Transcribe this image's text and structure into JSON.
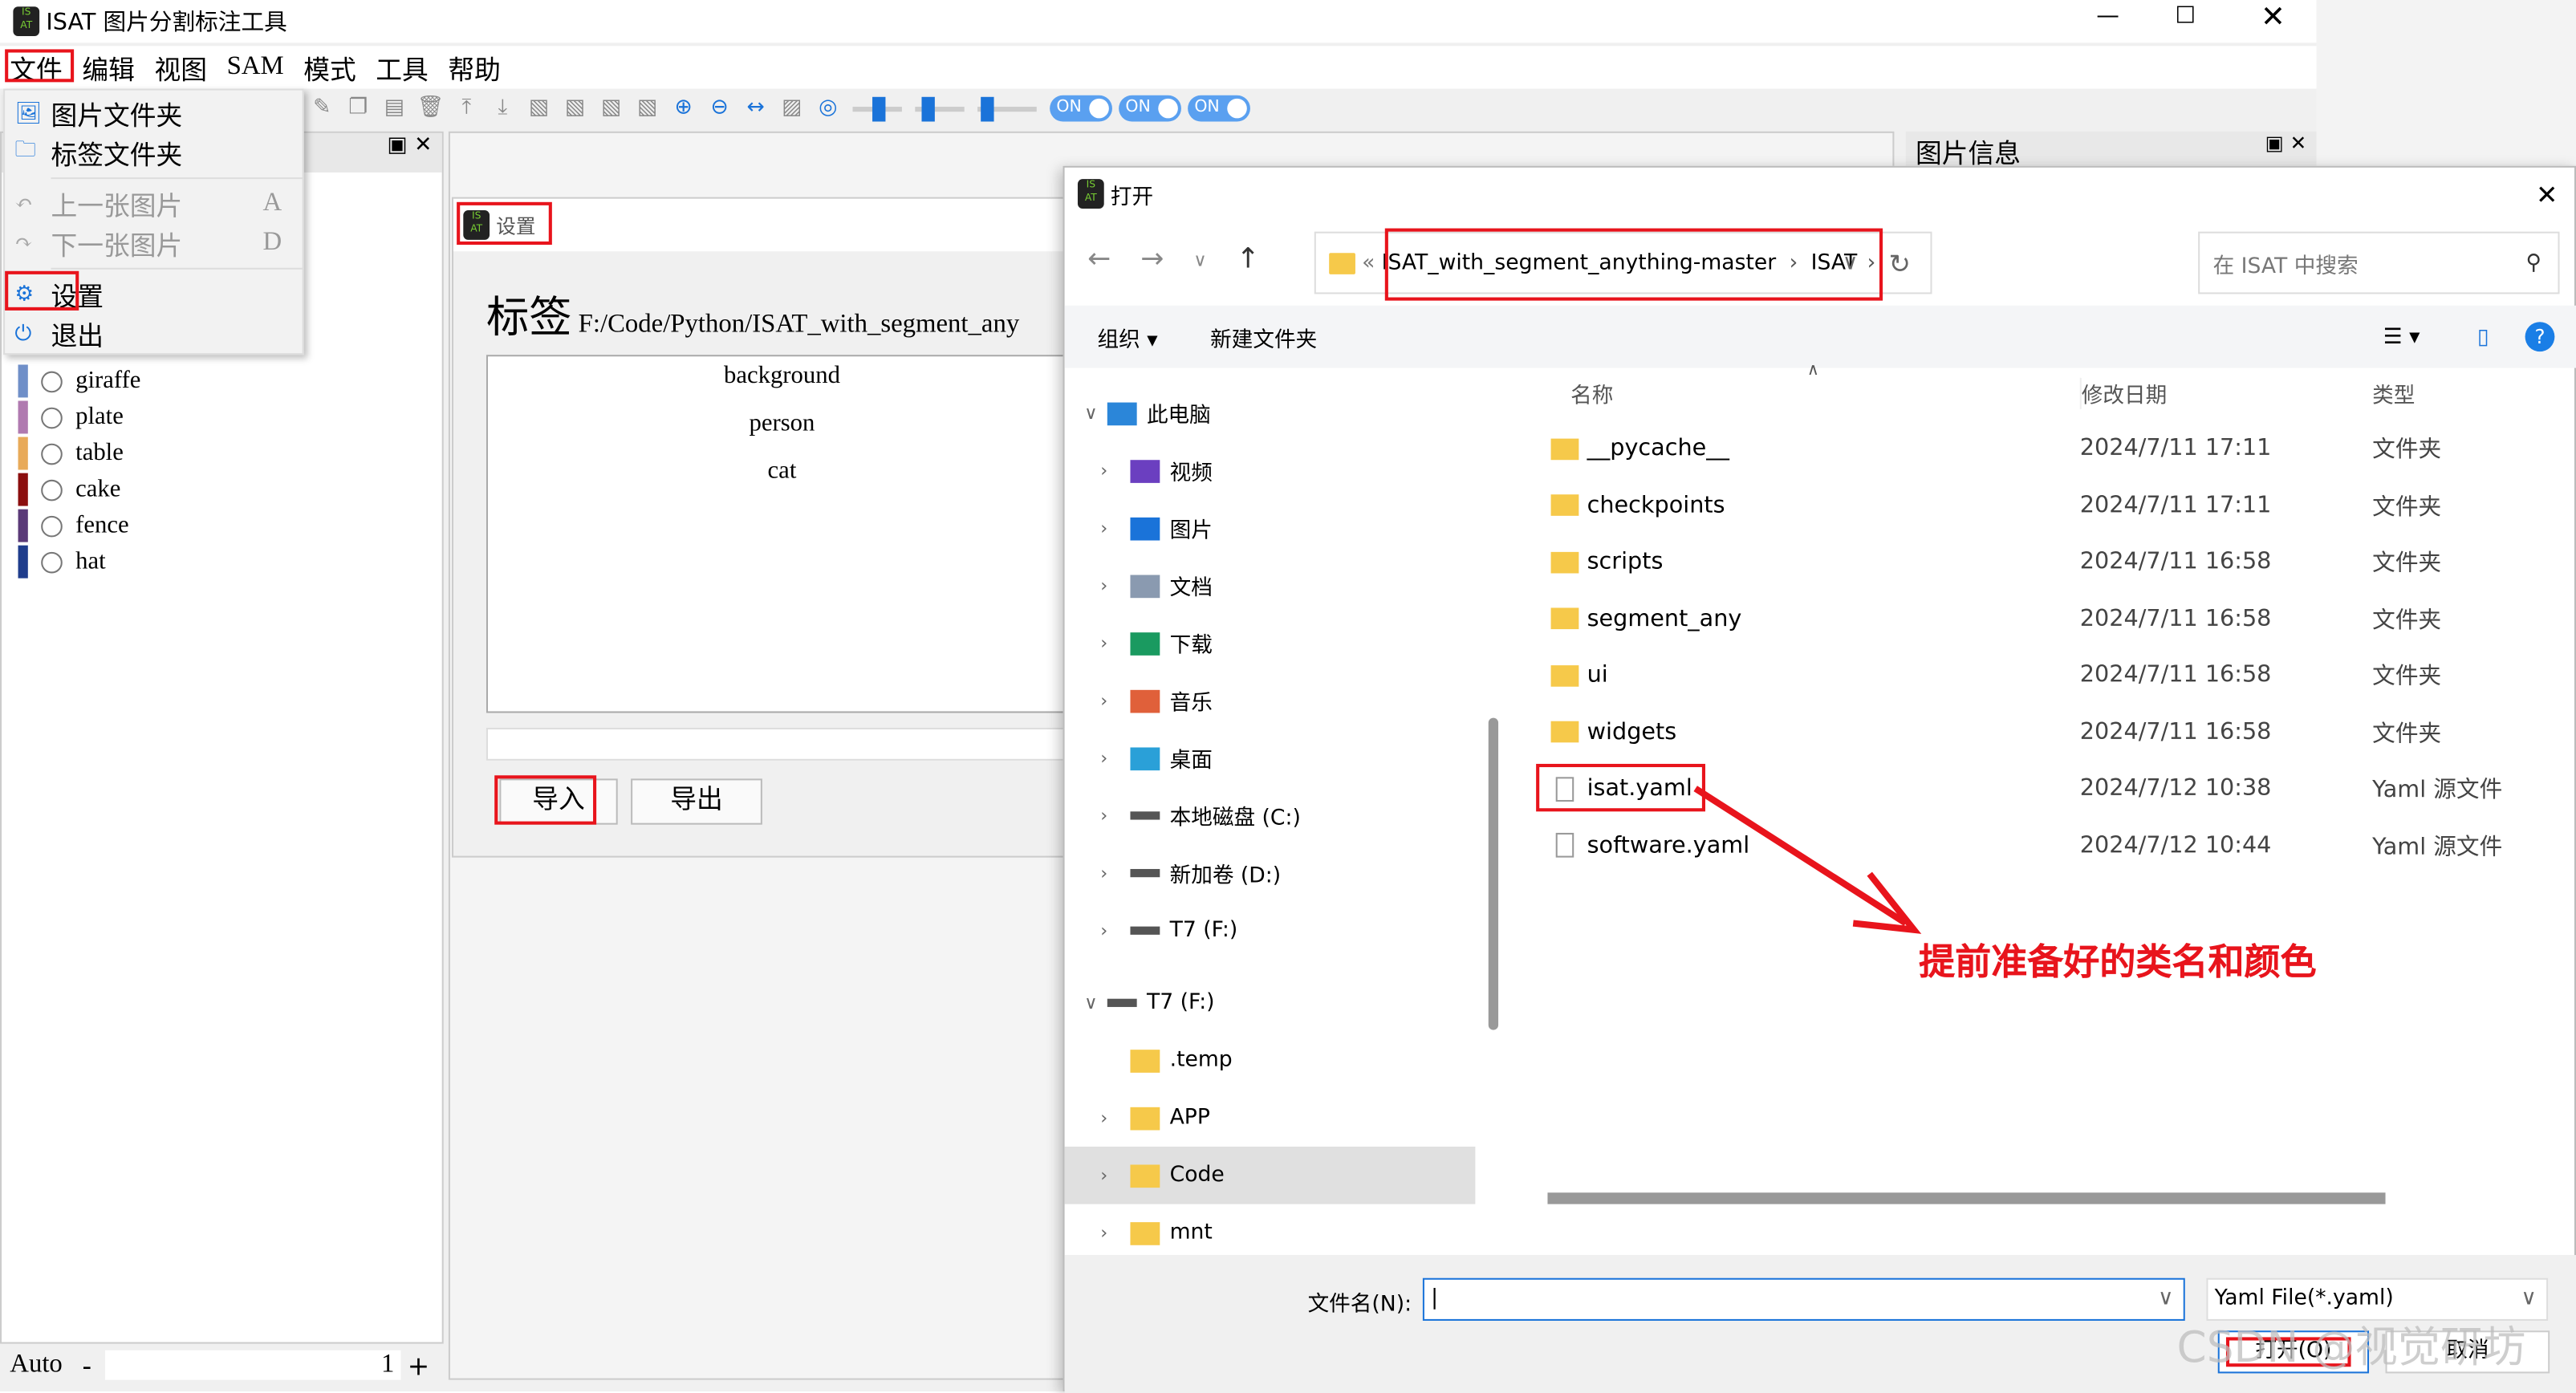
{
  "app": {
    "title": "ISAT 图片分割标注工具",
    "logo_text": "ISAT"
  },
  "menubar": [
    "文件",
    "编辑",
    "视图",
    "SAM",
    "模式",
    "工具",
    "帮助"
  ],
  "file_menu": [
    {
      "label": "图片文件夹",
      "icon": "image-folder-icon",
      "shortcut": "",
      "enabled": true
    },
    {
      "label": "标签文件夹",
      "icon": "folder-icon",
      "shortcut": "",
      "enabled": true
    },
    {
      "label": "上一张图片",
      "icon": "undo-arrow-icon",
      "shortcut": "A",
      "enabled": false
    },
    {
      "label": "下一张图片",
      "icon": "redo-arrow-icon",
      "shortcut": "D",
      "enabled": false
    },
    {
      "label": "设置",
      "icon": "gear-icon",
      "shortcut": "",
      "enabled": true
    },
    {
      "label": "退出",
      "icon": "power-icon",
      "shortcut": "",
      "enabled": true
    }
  ],
  "toolbar": {
    "toggles": [
      "ON",
      "ON",
      "ON"
    ]
  },
  "labels": [
    {
      "name": "giraffe",
      "color": "#6f8fc8"
    },
    {
      "name": "plate",
      "color": "#b07ab0"
    },
    {
      "name": "table",
      "color": "#e8aa5a"
    },
    {
      "name": "cake",
      "color": "#8b0e0e"
    },
    {
      "name": "fence",
      "color": "#5b3a78"
    },
    {
      "name": "hat",
      "color": "#1f3d8c"
    }
  ],
  "bottom_bar": {
    "mode": "Auto",
    "minus": "-",
    "value": "1",
    "plus": "+"
  },
  "image_info_panel": {
    "title": "图片信息"
  },
  "settings_dialog": {
    "title": "设置",
    "label_heading": "标签",
    "path": "F:/Code/Python/ISAT_with_segment_any",
    "categories": [
      "background",
      "person",
      "cat"
    ],
    "import_label": "导入",
    "export_label": "导出"
  },
  "open_dialog": {
    "title": "打开",
    "breadcrumb": [
      "ISAT_with_segment_anything-master",
      "ISAT"
    ],
    "search_placeholder": "在 ISAT 中搜索",
    "organize": "组织 ▾",
    "new_folder": "新建文件夹",
    "columns": {
      "name": "名称",
      "date": "修改日期",
      "type": "类型"
    },
    "nav_tree": [
      {
        "label": "此电脑",
        "icon": "computer-icon",
        "level": 0,
        "expanded": true
      },
      {
        "label": "视频",
        "icon": "video-icon",
        "level": 1
      },
      {
        "label": "图片",
        "icon": "pictures-icon",
        "level": 1
      },
      {
        "label": "文档",
        "icon": "documents-icon",
        "level": 1
      },
      {
        "label": "下载",
        "icon": "download-icon",
        "level": 1
      },
      {
        "label": "音乐",
        "icon": "music-icon",
        "level": 1
      },
      {
        "label": "桌面",
        "icon": "desktop-icon",
        "level": 1
      },
      {
        "label": "本地磁盘 (C:)",
        "icon": "drive-icon",
        "level": 1
      },
      {
        "label": "新加卷 (D:)",
        "icon": "drive-icon",
        "level": 1
      },
      {
        "label": "T7 (F:)",
        "icon": "drive-icon",
        "level": 1
      },
      {
        "label": "T7 (F:)",
        "icon": "drive-icon",
        "level": 0,
        "expanded": true
      },
      {
        "label": ".temp",
        "icon": "folder-icon",
        "level": 1
      },
      {
        "label": "APP",
        "icon": "folder-icon",
        "level": 1
      },
      {
        "label": "Code",
        "icon": "folder-icon",
        "level": 1,
        "selected": true
      },
      {
        "label": "mnt",
        "icon": "folder-icon",
        "level": 1
      }
    ],
    "files": [
      {
        "name": "__pycache__",
        "date": "2024/7/11 17:11",
        "type": "文件夹",
        "kind": "folder"
      },
      {
        "name": "checkpoints",
        "date": "2024/7/11 17:11",
        "type": "文件夹",
        "kind": "folder"
      },
      {
        "name": "scripts",
        "date": "2024/7/11 16:58",
        "type": "文件夹",
        "kind": "folder"
      },
      {
        "name": "segment_any",
        "date": "2024/7/11 16:58",
        "type": "文件夹",
        "kind": "folder"
      },
      {
        "name": "ui",
        "date": "2024/7/11 16:58",
        "type": "文件夹",
        "kind": "folder"
      },
      {
        "name": "widgets",
        "date": "2024/7/11 16:58",
        "type": "文件夹",
        "kind": "folder"
      },
      {
        "name": "isat.yaml",
        "date": "2024/7/12 10:38",
        "type": "Yaml 源文件",
        "kind": "file"
      },
      {
        "name": "software.yaml",
        "date": "2024/7/12 10:44",
        "type": "Yaml 源文件",
        "kind": "file"
      }
    ],
    "filename_label": "文件名(N):",
    "filename_value": "",
    "filter": "Yaml File(*.yaml)",
    "open_button": "打开(O)",
    "cancel_button": "取消"
  },
  "annotation": {
    "text": "提前准备好的类名和颜色",
    "color": "#e8141c"
  },
  "watermark": "CSDN @视觉研坊"
}
